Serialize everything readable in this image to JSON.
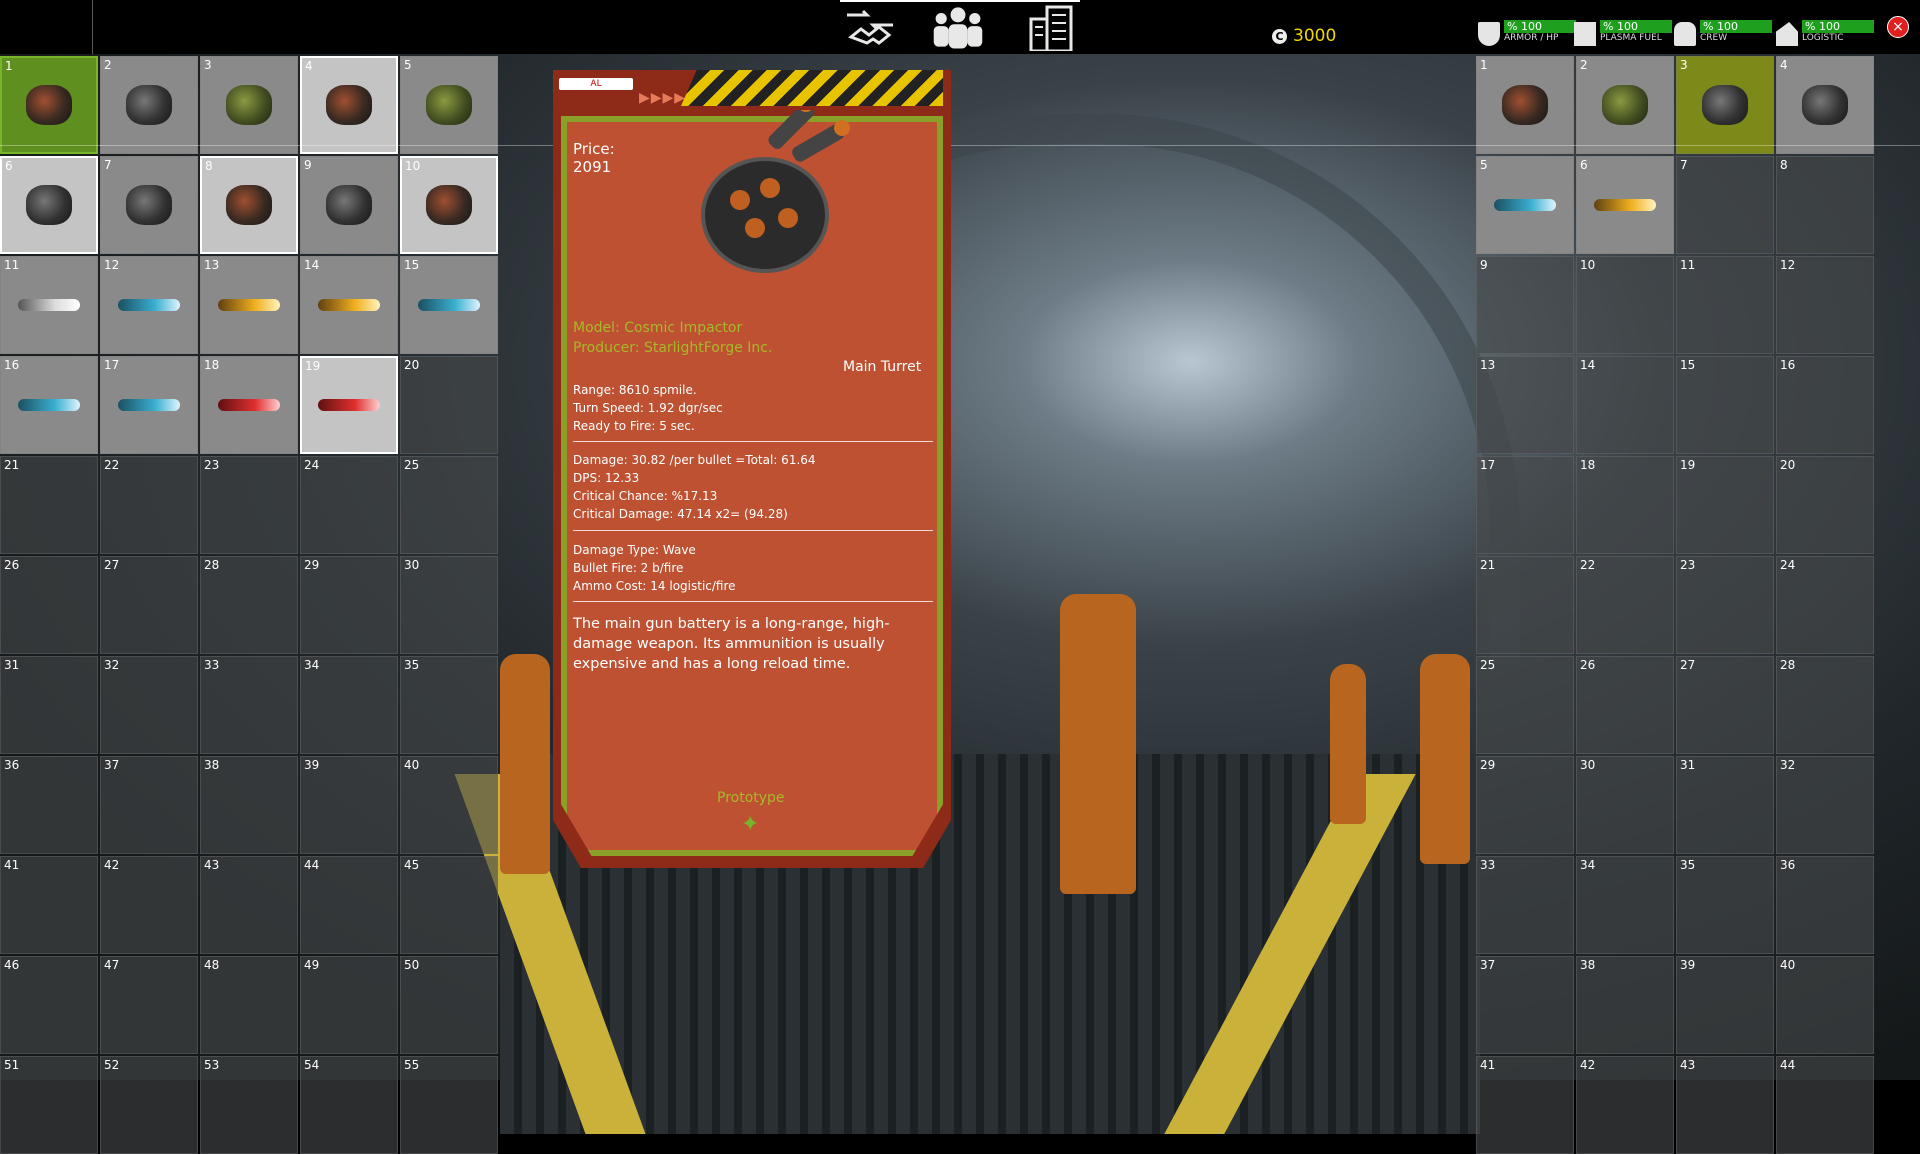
{
  "nav": {
    "icons": [
      "trade-icon",
      "crew-icon",
      "buildings-icon"
    ]
  },
  "credits": {
    "icon": "credit-icon",
    "value": "3000"
  },
  "status": [
    {
      "name": "armor-hp-icon",
      "value": "% 100",
      "label": "ARMOR / HP"
    },
    {
      "name": "plasma-fuel-icon",
      "value": "% 100",
      "label": "PLASMA FUEL"
    },
    {
      "name": "crew-icon",
      "value": "% 100",
      "label": "CREW"
    },
    {
      "name": "logistic-icon",
      "value": "% 100",
      "label": "LOGISTIC"
    }
  ],
  "close_label": "×",
  "panel": {
    "tag": "AL",
    "arrows": "▶▶▶▶",
    "price_label": "Price:",
    "price": "2091",
    "model": "Model: Cosmic Impactor",
    "producer": "Producer: StarlightForge Inc.",
    "type": "Main Turret",
    "stats_a": [
      "Range: 8610 spmile.",
      "Turn Speed: 1.92 dgr/sec",
      "Ready to Fire: 5 sec."
    ],
    "stats_b": [
      "Damage: 30.82 /per bullet =Total: 61.64",
      "DPS: 12.33",
      "Critical Chance: %17.13",
      "Critical Damage: 47.14 x2= (94.28)"
    ],
    "stats_c": [
      "Damage Type: Wave",
      "Bullet Fire: 2 b/fire",
      "Ammo Cost: 14 logistic/fire"
    ],
    "description": "The main gun battery is a long-range, high-damage weapon. Its ammunition is usually expensive and has a long reload time.",
    "rarity": "Prototype"
  },
  "left_inventory": {
    "slots": [
      "1",
      "2",
      "3",
      "4",
      "5",
      "6",
      "7",
      "8",
      "9",
      "10",
      "11",
      "12",
      "13",
      "14",
      "15",
      "16",
      "17",
      "18",
      "19",
      "20",
      "21",
      "22",
      "23",
      "24",
      "25",
      "26",
      "27",
      "28",
      "29",
      "30",
      "31",
      "32",
      "33",
      "34",
      "35",
      "36",
      "37",
      "38",
      "39",
      "40",
      "41",
      "42",
      "43",
      "44",
      "45",
      "46",
      "47",
      "48",
      "49",
      "50",
      "51",
      "52",
      "53",
      "54",
      "55"
    ],
    "items": {
      "1": "turret-red",
      "2": "turret",
      "3": "turret-green",
      "4": "turret-red",
      "5": "turret-green",
      "6": "turret",
      "7": "turret",
      "8": "turret-red",
      "9": "turret",
      "10": "turret-red",
      "11": "missile-white",
      "12": "missile",
      "13": "missile-yellow",
      "14": "missile-yellow",
      "15": "missile",
      "16": "missile",
      "17": "missile",
      "18": "missile-red",
      "19": "missile-red"
    }
  },
  "right_inventory": {
    "slots": [
      "1",
      "2",
      "3",
      "4",
      "5",
      "6",
      "7",
      "8",
      "9",
      "10",
      "11",
      "12",
      "13",
      "14",
      "15",
      "16",
      "17",
      "18",
      "19",
      "20",
      "21",
      "22",
      "23",
      "24",
      "25",
      "26",
      "27",
      "28",
      "29",
      "30",
      "31",
      "32",
      "33",
      "34",
      "35",
      "36",
      "37",
      "38",
      "39",
      "40",
      "41",
      "42",
      "43",
      "44"
    ],
    "items": {
      "1": "turret-red",
      "2": "turret-green",
      "3": "turret",
      "4": "turret",
      "5": "missile",
      "6": "missile-yellow"
    }
  }
}
